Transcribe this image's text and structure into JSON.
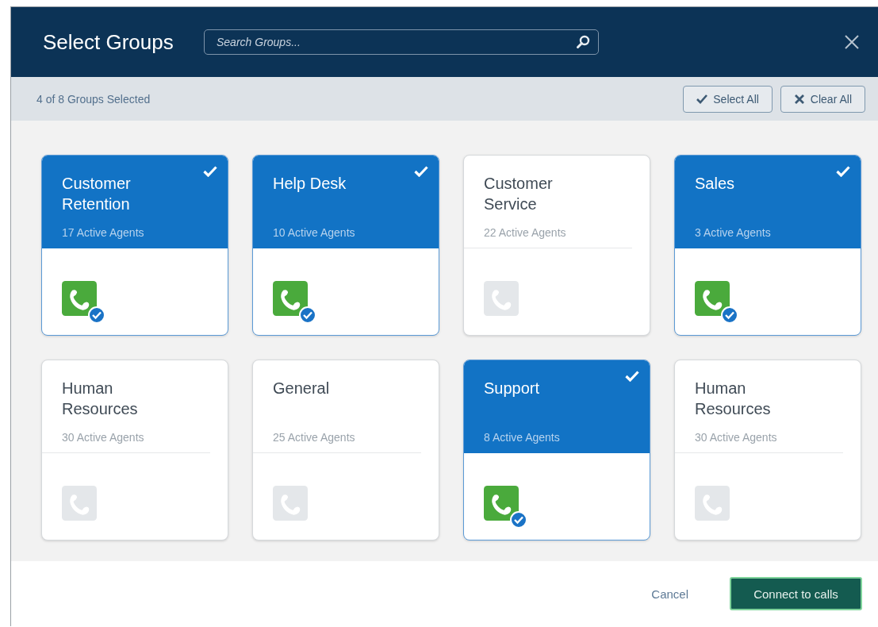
{
  "dialog": {
    "title": "Select Groups"
  },
  "search": {
    "placeholder": "Search Groups..."
  },
  "toolbar": {
    "count": "4 of 8 Groups Selected",
    "buttons": [
      {
        "kind": "select",
        "label": "Select All"
      },
      {
        "kind": "clear",
        "label": "Clear All"
      }
    ]
  },
  "groups": [
    {
      "name": "Customer Retention",
      "agents": "17 Active Agents",
      "selected": true
    },
    {
      "name": "Help Desk",
      "agents": "10 Active Agents",
      "selected": true
    },
    {
      "name": "Customer Service",
      "agents": "22 Active Agents",
      "selected": false
    },
    {
      "name": "Sales",
      "agents": "3 Active Agents",
      "selected": true
    },
    {
      "name": "Human Resources",
      "agents": "30 Active Agents",
      "selected": false
    },
    {
      "name": "General",
      "agents": "25 Active Agents",
      "selected": false
    },
    {
      "name": "Support",
      "agents": "8 Active Agents",
      "selected": true
    },
    {
      "name": "Human Resources",
      "agents": "30 Active Agents",
      "selected": false
    }
  ],
  "footer": {
    "cancel": "Cancel",
    "confirm": "Connect to calls"
  }
}
